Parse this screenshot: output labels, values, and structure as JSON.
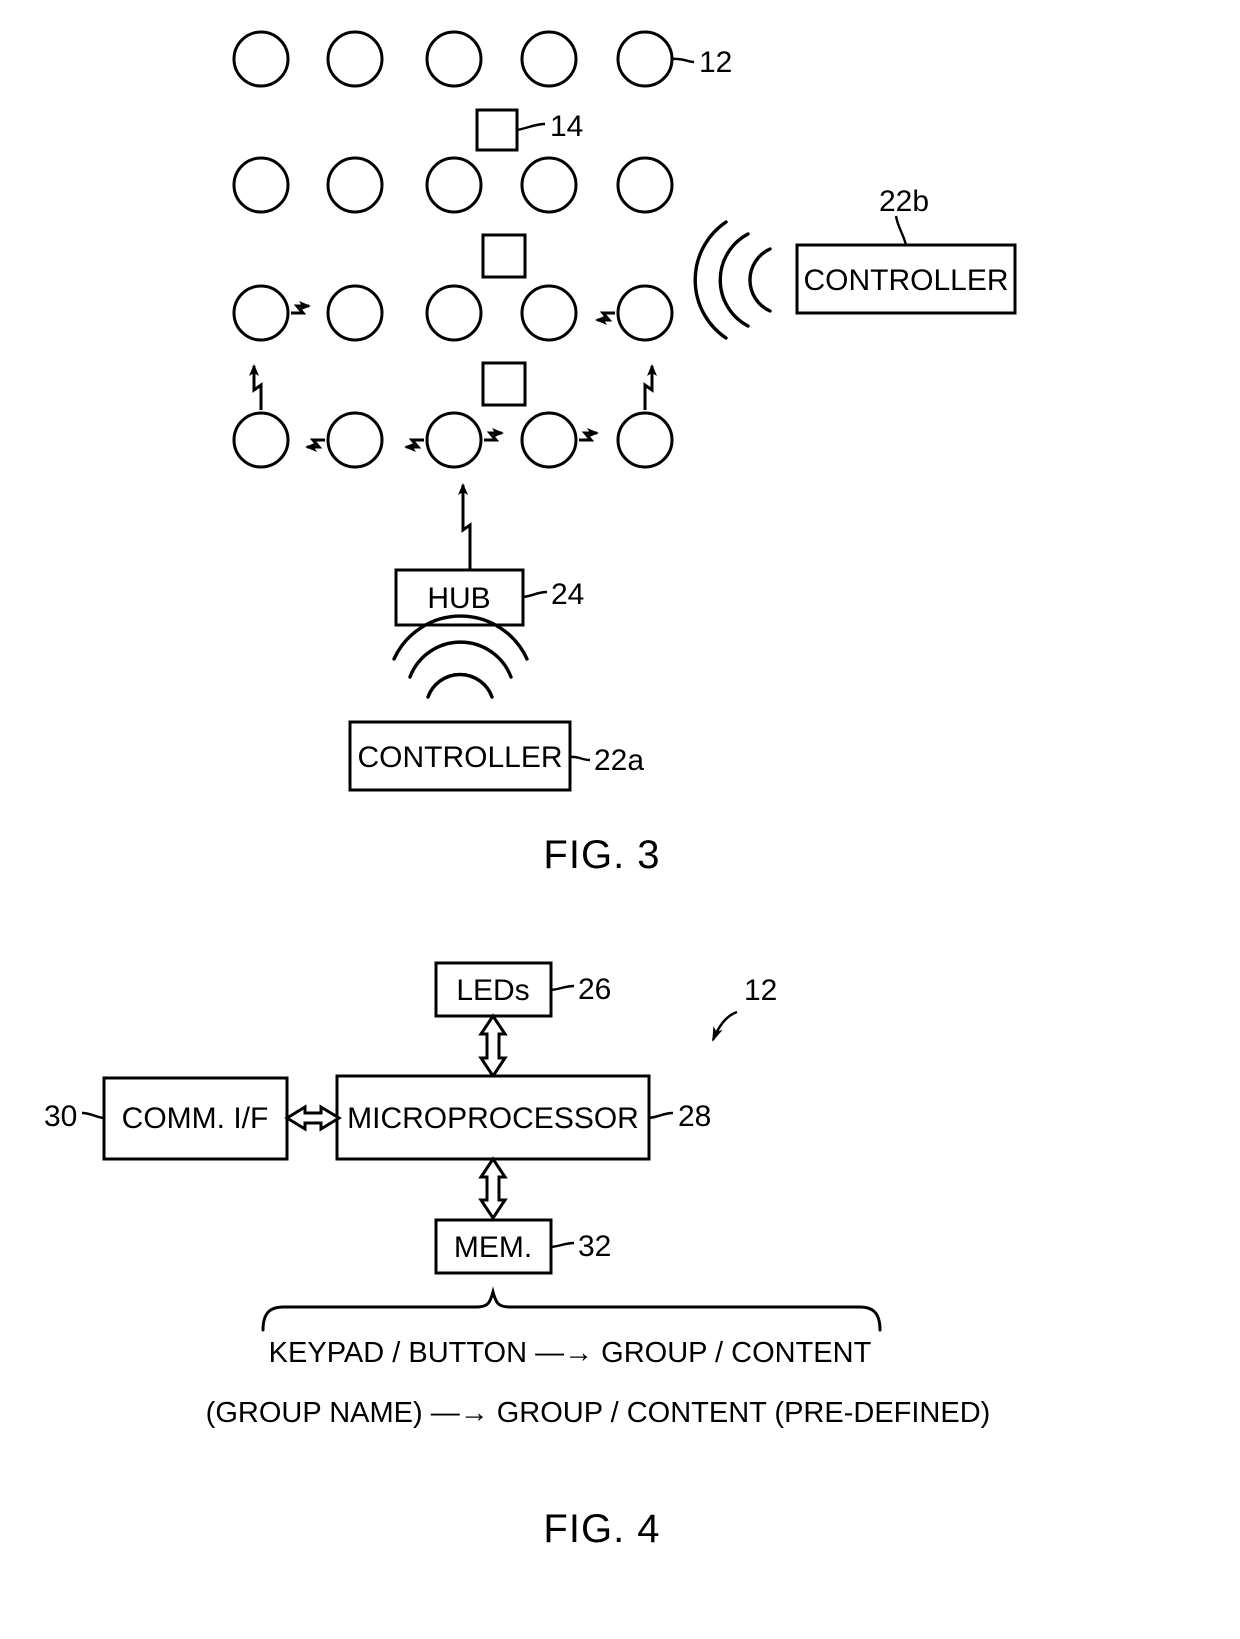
{
  "figures": [
    {
      "caption": "FIG. 3",
      "reference_numerals": {
        "luminaire": "12",
        "sensor": "14",
        "controller_wireless": "22b",
        "controller_hub": "22a",
        "hub": "24"
      },
      "boxes": {
        "controller_b": "CONTROLLER",
        "controller_a": "CONTROLLER",
        "hub": "HUB"
      },
      "grid": {
        "rows": 4,
        "columns": 5,
        "squares": 3
      }
    },
    {
      "caption": "FIG. 4",
      "reference_numerals": {
        "device": "12",
        "leds": "26",
        "microprocessor": "28",
        "comm_if": "30",
        "memory": "32"
      },
      "boxes": {
        "leds": "LEDs",
        "comm_if": "COMM. I/F",
        "microprocessor": "MICROPROCESSOR",
        "memory": "MEM."
      },
      "mapping_lines": [
        "KEYPAD / BUTTON —→ GROUP / CONTENT",
        "(GROUP NAME) —→ GROUP / CONTENT (PRE-DEFINED)"
      ]
    }
  ],
  "fig3": {
    "caption": "FIG. 3",
    "label_12": "12",
    "label_14": "14",
    "label_22b": "22b",
    "label_22a": "22a",
    "label_24": "24",
    "controller_b_text": "CONTROLLER",
    "controller_a_text": "CONTROLLER",
    "hub_text": "HUB"
  },
  "fig4": {
    "caption": "FIG. 4",
    "label_12": "12",
    "label_26": "26",
    "label_28": "28",
    "label_30": "30",
    "label_32": "32",
    "leds_text": "LEDs",
    "comm_text": "COMM. I/F",
    "micro_text": "MICROPROCESSOR",
    "mem_text": "MEM.",
    "map_line_1": "KEYPAD / BUTTON —→ GROUP / CONTENT",
    "map_line_2": "(GROUP NAME) —→ GROUP / CONTENT (PRE-DEFINED)"
  },
  "colors": {
    "ink": "#000000",
    "paper": "#ffffff"
  }
}
